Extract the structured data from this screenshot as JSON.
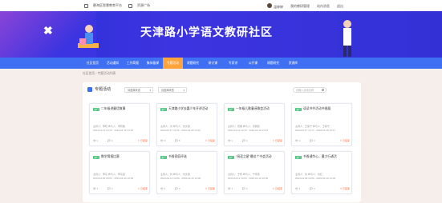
{
  "topbar": {
    "platform": "静海区智慧教育平台",
    "square": "资源广场",
    "user": "温婷婷",
    "my_studio": "我的教研管理",
    "messages": "站内消息",
    "exit": "退出"
  },
  "banner": {
    "title": "天津路小学语文教研社区"
  },
  "nav": {
    "items": [
      "社区首页",
      "活动通知",
      "工作简报",
      "集体备课",
      "专题活动",
      "课题研究",
      "研讨课",
      "专家讲",
      "公开课",
      "课题研究",
      "资源库"
    ],
    "active_index": 4
  },
  "breadcrumb": "社区首页  ›  专题活动列表",
  "panel": {
    "title": "专题活动",
    "filter1": "请选择状态",
    "filter2": "请选择状态",
    "search_placeholder": "请输入活动名称"
  },
  "cards": [
    {
      "tag": "进行",
      "title": "二年级讲童话故事",
      "meta": "主持人：李晓 参与人：李晓敏",
      "date": "2024-04-12 23:43 - 2024-04-18 13:43",
      "views": "1",
      "comments": "4",
      "status": "已结束"
    },
    {
      "tag": "进行",
      "title": "天津路小学去嘉少年开讲活动",
      "meta": "主持人：刘 参与人：刘文丽",
      "date": "2024-04-17 11:26 - 2024-04-26 13:43",
      "views": "6",
      "comments": "5",
      "status": "已结束"
    },
    {
      "tag": "进行",
      "title": "一年级儿歌童谣歌会活动",
      "meta": "主持人：贾娟 参与人：贾娟凯",
      "date": "2024-04-12 12:43 - 2024-04-13 13:43",
      "views": "1",
      "comments": "4",
      "status": "已结束"
    },
    {
      "tag": "进行",
      "title": "读读书节活动书香展",
      "meta": "主持人：王紫宁 参与人：王紫宁",
      "date": "2024-04-17 10:17 - 2024-04-18 10:17",
      "views": "1",
      "comments": "4",
      "status": "已结束"
    },
    {
      "tag": "进行",
      "title": "数学简报比赛",
      "meta": "主持人：李东 参与人：李东园",
      "date": "2024-04-06 09:00 - 2024-04-10 10:00",
      "views": "1",
      "comments": "4",
      "status": "已结束"
    },
    {
      "tag": "进行",
      "title": "书香家庭评选",
      "meta": "主持人：刘 参与人：刘文丽",
      "date": "2024-04-12 14:00 - 2024-04-12 14:00",
      "views": "1",
      "comments": "4",
      "status": "已结束"
    },
    {
      "tag": "进行",
      "title": "\"阅读之星\"最佳个书会活动",
      "meta": "主持人：宁伟 参与人：宁伟伟",
      "date": "2024-04-12 14:00 - 2024-04-12 16:00",
      "views": "1",
      "comments": "4",
      "status": "已结束"
    },
    {
      "tag": "进行",
      "title": "书香诵华心，墨力行诵活",
      "meta": "主持人：刘 参与人：刘红",
      "date": "2024-04-09 14:00 - 2024-04-10 14:00",
      "views": "1",
      "comments": "4",
      "status": "已结束"
    }
  ]
}
